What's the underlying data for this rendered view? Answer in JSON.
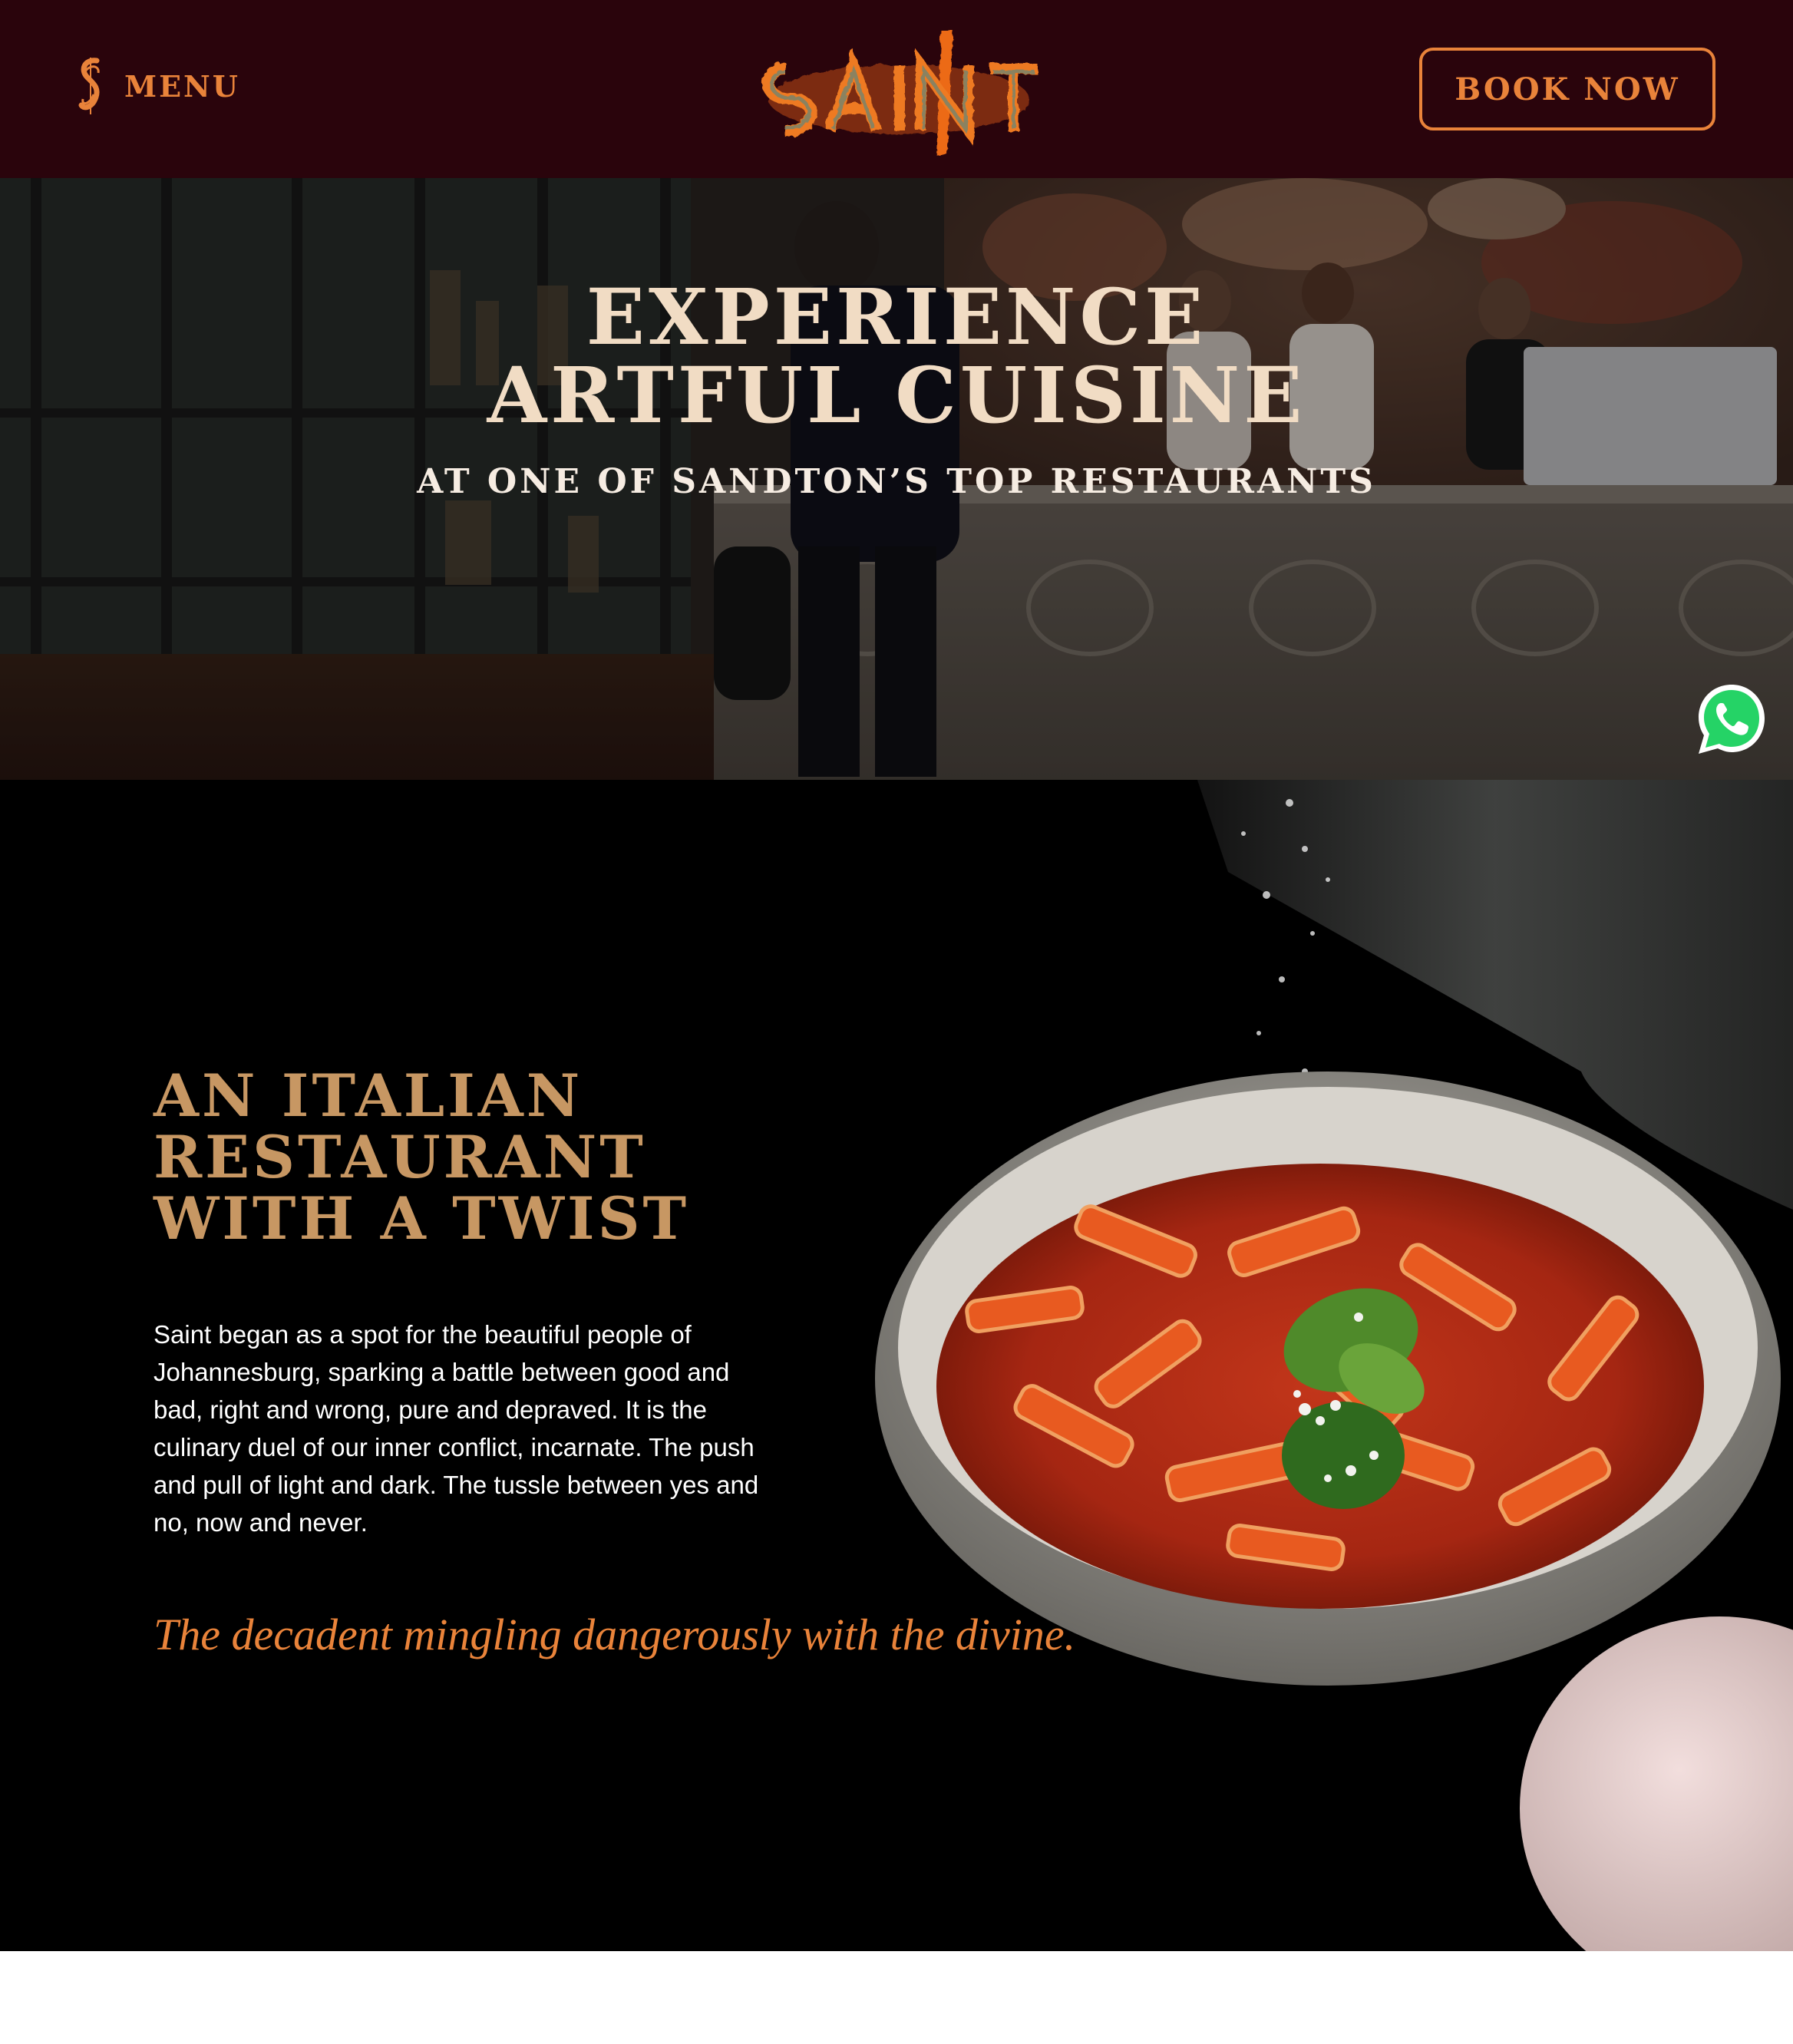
{
  "header": {
    "menu_label": "MENU",
    "logo_text": "SAINT",
    "book_label": "BOOK NOW"
  },
  "hero": {
    "title_line1": "EXPERIENCE",
    "title_line2": "ARTFUL CUISINE",
    "subtitle": "AT ONE OF SANDTON’S TOP RESTAURANTS"
  },
  "intro": {
    "heading_line1": "AN ITALIAN",
    "heading_line2": "RESTAURANT",
    "heading_line3": "WITH A TWIST",
    "body": "Saint began as a spot for the beautiful people of Johannesburg, sparking a battle between good and bad, right and wrong, pure and depraved. It is the culinary duel of our inner conflict, incarnate. The push and pull of light and dark. The tussle between yes and no, now and never.",
    "quote": "The decadent mingling dangerously with the divine."
  },
  "icons": {
    "menu": "s-monogram-icon",
    "chat": "whatsapp-icon"
  },
  "colors": {
    "header_bg": "#2a040c",
    "accent_orange": "#e9833a",
    "heading_gold": "#c79763",
    "hero_text": "#f1dcc4",
    "body_text": "#ffffff",
    "intro_bg": "#000000",
    "whatsapp_green": "#25d366"
  }
}
